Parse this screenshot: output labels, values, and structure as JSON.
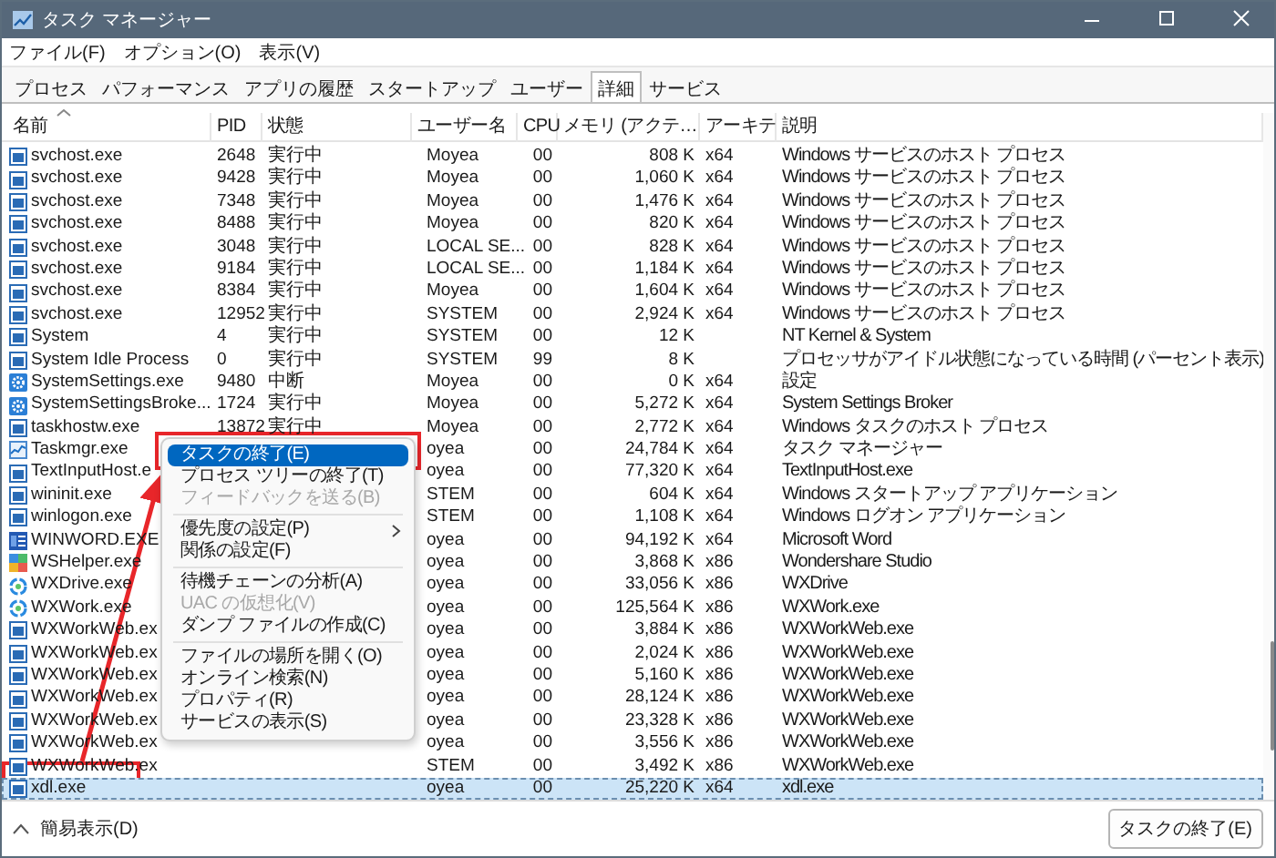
{
  "window": {
    "title": "タスク マネージャー"
  },
  "menu_bar": [
    "ファイル(F)",
    "オプション(O)",
    "表示(V)"
  ],
  "tabs": [
    {
      "label": "プロセス",
      "selected": false
    },
    {
      "label": "パフォーマンス",
      "selected": false
    },
    {
      "label": "アプリの履歴",
      "selected": false
    },
    {
      "label": "スタートアップ",
      "selected": false
    },
    {
      "label": "ユーザー",
      "selected": false
    },
    {
      "label": "詳細",
      "selected": true
    },
    {
      "label": "サービス",
      "selected": false
    }
  ],
  "table": {
    "columns": [
      "名前",
      "PID",
      "状態",
      "ユーザー名",
      "CPU",
      "メモリ (アクテ…",
      "アーキテ",
      "説明"
    ],
    "rows": [
      {
        "kind": "window",
        "name": "svchost.exe",
        "pid": "2648",
        "status": "実行中",
        "user": "Moyea",
        "cpu": "00",
        "memory": "808 K",
        "arch": "x64",
        "description": "Windows サービスのホスト プロセス",
        "selected": false
      },
      {
        "kind": "window",
        "name": "svchost.exe",
        "pid": "9428",
        "status": "実行中",
        "user": "Moyea",
        "cpu": "00",
        "memory": "1,060 K",
        "arch": "x64",
        "description": "Windows サービスのホスト プロセス",
        "selected": false
      },
      {
        "kind": "window",
        "name": "svchost.exe",
        "pid": "7348",
        "status": "実行中",
        "user": "Moyea",
        "cpu": "00",
        "memory": "1,476 K",
        "arch": "x64",
        "description": "Windows サービスのホスト プロセス",
        "selected": false
      },
      {
        "kind": "window",
        "name": "svchost.exe",
        "pid": "8488",
        "status": "実行中",
        "user": "Moyea",
        "cpu": "00",
        "memory": "820 K",
        "arch": "x64",
        "description": "Windows サービスのホスト プロセス",
        "selected": false
      },
      {
        "kind": "window",
        "name": "svchost.exe",
        "pid": "3048",
        "status": "実行中",
        "user": "LOCAL SE...",
        "cpu": "00",
        "memory": "828 K",
        "arch": "x64",
        "description": "Windows サービスのホスト プロセス",
        "selected": false
      },
      {
        "kind": "window",
        "name": "svchost.exe",
        "pid": "9184",
        "status": "実行中",
        "user": "LOCAL SE...",
        "cpu": "00",
        "memory": "1,184 K",
        "arch": "x64",
        "description": "Windows サービスのホスト プロセス",
        "selected": false
      },
      {
        "kind": "window",
        "name": "svchost.exe",
        "pid": "8384",
        "status": "実行中",
        "user": "Moyea",
        "cpu": "00",
        "memory": "1,604 K",
        "arch": "x64",
        "description": "Windows サービスのホスト プロセス",
        "selected": false
      },
      {
        "kind": "window",
        "name": "svchost.exe",
        "pid": "12952",
        "status": "実行中",
        "user": "SYSTEM",
        "cpu": "00",
        "memory": "2,924 K",
        "arch": "x64",
        "description": "Windows サービスのホスト プロセス",
        "selected": false
      },
      {
        "kind": "window",
        "name": "System",
        "pid": "4",
        "status": "実行中",
        "user": "SYSTEM",
        "cpu": "00",
        "memory": "12 K",
        "description": "NT Kernel & System",
        "selected": false
      },
      {
        "kind": "window",
        "name": "System Idle Process",
        "pid": "0",
        "status": "実行中",
        "user": "SYSTEM",
        "cpu": "99",
        "memory": "8 K",
        "description": "プロセッサがアイドル状態になっている時間 (パーセント表示)",
        "selected": false
      },
      {
        "kind": "gear",
        "name": "SystemSettings.exe",
        "pid": "9480",
        "status": "中断",
        "user": "Moyea",
        "cpu": "00",
        "memory": "0 K",
        "arch": "x64",
        "description": "設定",
        "selected": false
      },
      {
        "kind": "gear",
        "name": "SystemSettingsBroke...",
        "pid": "1724",
        "status": "実行中",
        "user": "Moyea",
        "cpu": "00",
        "memory": "5,272 K",
        "arch": "x64",
        "description": "System Settings Broker",
        "selected": false
      },
      {
        "kind": "window",
        "name": "taskhostw.exe",
        "pid": "13872",
        "status": "実行中",
        "user": "Moyea",
        "cpu": "00",
        "memory": "2,772 K",
        "arch": "x64",
        "description": "Windows タスクのホスト プロセス",
        "selected": false
      },
      {
        "kind": "chart",
        "name": "Taskmgr.exe",
        "user": "oyea",
        "cpu": "00",
        "memory": "24,784 K",
        "arch": "x64",
        "description": "タスク マネージャー",
        "selected": false
      },
      {
        "kind": "window",
        "name": "TextInputHost.e",
        "user": "oyea",
        "cpu": "00",
        "memory": "77,320 K",
        "arch": "x64",
        "description": "TextInputHost.exe",
        "selected": false
      },
      {
        "kind": "window",
        "name": "wininit.exe",
        "user": "STEM",
        "cpu": "00",
        "memory": "604 K",
        "arch": "x64",
        "description": "Windows スタートアップ アプリケーション",
        "selected": false
      },
      {
        "kind": "window",
        "name": "winlogon.exe",
        "user": "STEM",
        "cpu": "00",
        "memory": "1,108 K",
        "arch": "x64",
        "description": "Windows ログオン アプリケーション",
        "selected": false
      },
      {
        "kind": "document",
        "name": "WINWORD.EXE",
        "user": "oyea",
        "cpu": "00",
        "memory": "94,192 K",
        "arch": "x64",
        "description": "Microsoft Word",
        "selected": false
      },
      {
        "kind": "tile",
        "name": "WSHelper.exe",
        "user": "oyea",
        "cpu": "00",
        "memory": "3,868 K",
        "arch": "x86",
        "description": "Wondershare Studio",
        "selected": false
      },
      {
        "kind": "cloud",
        "name": "WXDrive.exe",
        "user": "oyea",
        "cpu": "00",
        "memory": "33,056 K",
        "arch": "x86",
        "description": "WXDrive",
        "selected": false
      },
      {
        "kind": "cloud",
        "name": "WXWork.exe",
        "user": "oyea",
        "cpu": "00",
        "memory": "125,564 K",
        "arch": "x86",
        "description": "WXWork.exe",
        "selected": false
      },
      {
        "kind": "window",
        "name": "WXWorkWeb.ex",
        "user": "oyea",
        "cpu": "00",
        "memory": "3,884 K",
        "arch": "x86",
        "description": "WXWorkWeb.exe",
        "selected": false
      },
      {
        "kind": "window",
        "name": "WXWorkWeb.ex",
        "user": "oyea",
        "cpu": "00",
        "memory": "2,024 K",
        "arch": "x86",
        "description": "WXWorkWeb.exe",
        "selected": false
      },
      {
        "kind": "window",
        "name": "WXWorkWeb.ex",
        "user": "oyea",
        "cpu": "00",
        "memory": "5,160 K",
        "arch": "x86",
        "description": "WXWorkWeb.exe",
        "selected": false
      },
      {
        "kind": "window",
        "name": "WXWorkWeb.ex",
        "user": "oyea",
        "cpu": "00",
        "memory": "28,124 K",
        "arch": "x86",
        "description": "WXWorkWeb.exe",
        "selected": false
      },
      {
        "kind": "window",
        "name": "WXWorkWeb.ex",
        "user": "oyea",
        "cpu": "00",
        "memory": "23,328 K",
        "arch": "x86",
        "description": "WXWorkWeb.exe",
        "selected": false
      },
      {
        "kind": "window",
        "name": "WXWorkWeb.ex",
        "user": "oyea",
        "cpu": "00",
        "memory": "3,556 K",
        "arch": "x86",
        "description": "WXWorkWeb.exe",
        "selected": false
      },
      {
        "kind": "window",
        "name": "WXWorkWeb.ex",
        "user": "STEM",
        "cpu": "00",
        "memory": "3,492 K",
        "arch": "x86",
        "description": "WXWorkWeb.exe",
        "selected": false
      },
      {
        "kind": "window",
        "name": "xdl.exe",
        "user": "oyea",
        "cpu": "00",
        "memory": "25,220 K",
        "arch": "x64",
        "description": "xdl.exe",
        "selected": true
      }
    ]
  },
  "context_menu": [
    {
      "kind": "item",
      "label": "タスクの終了(E)",
      "selected": true,
      "disabled": false,
      "submenu": false
    },
    {
      "kind": "item",
      "label": "プロセス ツリーの終了(T)",
      "selected": false,
      "disabled": false,
      "submenu": false
    },
    {
      "kind": "item",
      "label": "フィードバックを送る(B)",
      "selected": false,
      "disabled": true,
      "submenu": false
    },
    {
      "kind": "separator"
    },
    {
      "kind": "item",
      "label": "優先度の設定(P)",
      "selected": false,
      "disabled": false,
      "submenu": true
    },
    {
      "kind": "item",
      "label": "関係の設定(F)",
      "selected": false,
      "disabled": false,
      "submenu": false
    },
    {
      "kind": "separator"
    },
    {
      "kind": "item",
      "label": "待機チェーンの分析(A)",
      "selected": false,
      "disabled": false,
      "submenu": false
    },
    {
      "kind": "item",
      "label": "UAC の仮想化(V)",
      "selected": false,
      "disabled": true,
      "submenu": false
    },
    {
      "kind": "item",
      "label": "ダンプ ファイルの作成(C)",
      "selected": false,
      "disabled": false,
      "submenu": false
    },
    {
      "kind": "separator"
    },
    {
      "kind": "item",
      "label": "ファイルの場所を開く(O)",
      "selected": false,
      "disabled": false,
      "submenu": false
    },
    {
      "kind": "item",
      "label": "オンライン検索(N)",
      "selected": false,
      "disabled": false,
      "submenu": false
    },
    {
      "kind": "item",
      "label": "プロパティ(R)",
      "selected": false,
      "disabled": false,
      "submenu": false
    },
    {
      "kind": "item",
      "label": "サービスの表示(S)",
      "selected": false,
      "disabled": false,
      "submenu": false
    }
  ],
  "footer": {
    "toggle": "簡易表示(D)",
    "button": "タスクの終了(E)"
  }
}
